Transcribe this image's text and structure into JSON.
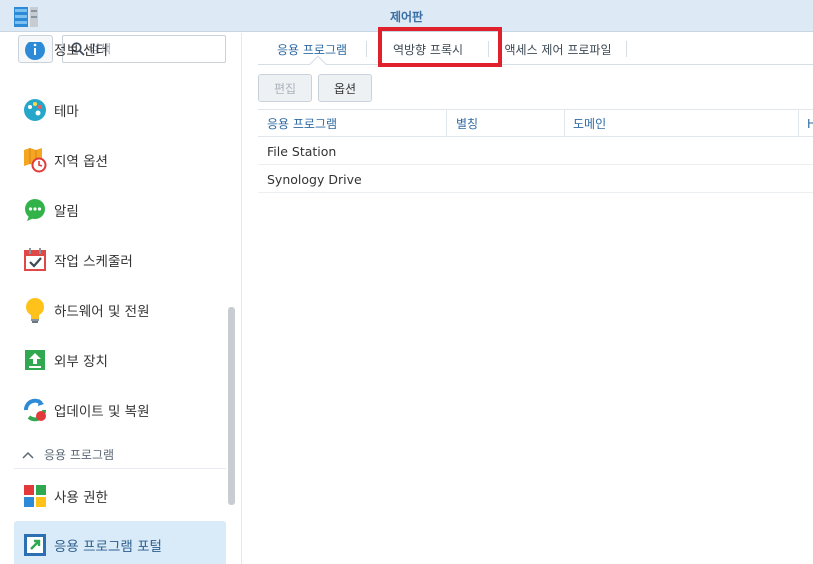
{
  "window": {
    "title": "제어판"
  },
  "sidebar": {
    "search_placeholder": "검색",
    "items": [
      {
        "label": "정보 센터",
        "icon": "info-icon"
      },
      {
        "label": "테마",
        "icon": "palette-icon"
      },
      {
        "label": "지역 옵션",
        "icon": "map-clock-icon"
      },
      {
        "label": "알림",
        "icon": "chat-bubble-icon"
      },
      {
        "label": "작업 스케줄러",
        "icon": "calendar-check-icon"
      },
      {
        "label": "하드웨어 및 전원",
        "icon": "lightbulb-icon"
      },
      {
        "label": "외부 장치",
        "icon": "upload-icon"
      },
      {
        "label": "업데이트 및 복원",
        "icon": "refresh-icon"
      }
    ],
    "section_label": "응용 프로그램",
    "section_items": [
      {
        "label": "사용 권한",
        "icon": "privileges-icon"
      },
      {
        "label": "응용 프로그램 포털",
        "icon": "portal-icon",
        "selected": true
      }
    ]
  },
  "tabs": [
    {
      "label": "응용 프로그램",
      "active": true
    },
    {
      "label": "역방향 프록시",
      "active": false
    },
    {
      "label": "액세스 제어 프로파일",
      "active": false
    }
  ],
  "toolbar": {
    "edit_label": "편집",
    "options_label": "옵션"
  },
  "table": {
    "columns": [
      "응용 프로그램",
      "별칭",
      "도메인",
      "H"
    ],
    "rows": [
      [
        "File Station"
      ],
      [
        "Synology Drive"
      ]
    ]
  },
  "colors": {
    "accent": "#2e6aa3",
    "highlight": "#e0202a",
    "selected_bg": "#d9eaf8"
  }
}
